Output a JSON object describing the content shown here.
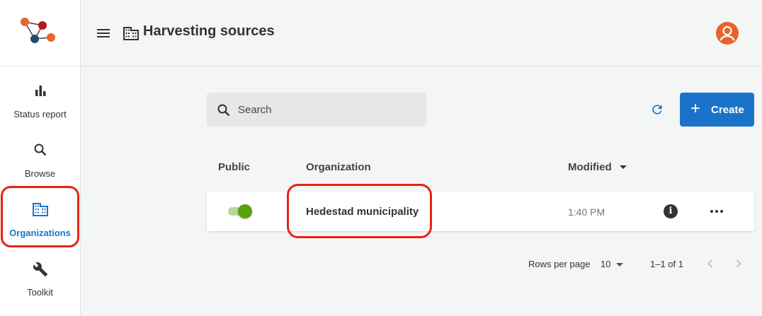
{
  "sidebar": {
    "items": [
      {
        "label": "Status report",
        "icon": "bar-chart-icon"
      },
      {
        "label": "Browse",
        "icon": "search-icon"
      },
      {
        "label": "Organizations",
        "icon": "building-icon",
        "active": true
      },
      {
        "label": "Toolkit",
        "icon": "wrench-icon"
      }
    ]
  },
  "header": {
    "title": "Harvesting sources",
    "icon": "building-icon"
  },
  "toolbar": {
    "search_placeholder": "Search",
    "create_label": "Create",
    "create_icon": "plus-icon",
    "refresh_icon": "refresh-icon"
  },
  "table": {
    "columns": [
      "Public",
      "Organization",
      "Modified"
    ],
    "sort_column": "Modified",
    "rows": [
      {
        "public": true,
        "organization": "Hedestad municipality",
        "modified": "1:40 PM"
      }
    ]
  },
  "pagination": {
    "rows_per_page_label": "Rows per page",
    "rows_per_page": "10",
    "range": "1–1 of 1"
  },
  "colors": {
    "accent": "#1a73c8",
    "toggle_on": "#5aa10c",
    "avatar": "#e8642b",
    "highlight": "#e8230e"
  }
}
